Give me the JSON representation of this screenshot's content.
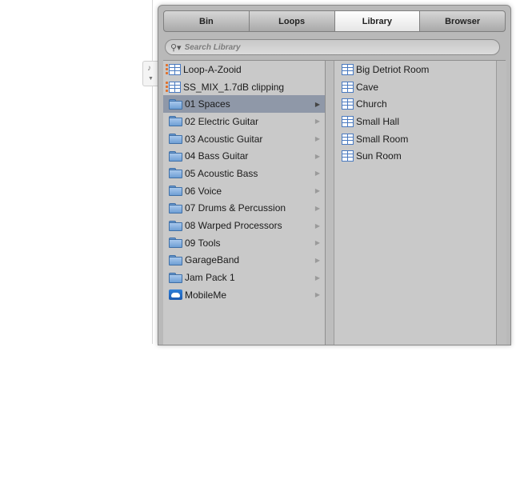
{
  "tabs": [
    {
      "label": "Bin"
    },
    {
      "label": "Loops"
    },
    {
      "label": "Library"
    },
    {
      "label": "Browser"
    }
  ],
  "search": {
    "placeholder": "Search Library"
  },
  "library_items": [
    {
      "label": "Loop-A-Zooid",
      "icon": "setting-file-icon"
    },
    {
      "label": "SS_MIX_1.7dB clipping",
      "icon": "setting-file-icon"
    },
    {
      "label": "01 Spaces",
      "icon": "folder-icon",
      "selected": true
    },
    {
      "label": "02 Electric Guitar",
      "icon": "folder-icon"
    },
    {
      "label": "03 Acoustic Guitar",
      "icon": "folder-icon"
    },
    {
      "label": "04 Bass Guitar",
      "icon": "folder-icon"
    },
    {
      "label": "05 Acoustic Bass",
      "icon": "folder-icon"
    },
    {
      "label": "06 Voice",
      "icon": "folder-icon"
    },
    {
      "label": "07 Drums & Percussion",
      "icon": "folder-icon"
    },
    {
      "label": "08 Warped Processors",
      "icon": "folder-icon"
    },
    {
      "label": "09 Tools",
      "icon": "folder-icon"
    },
    {
      "label": "GarageBand",
      "icon": "folder-icon"
    },
    {
      "label": "Jam Pack 1",
      "icon": "folder-icon"
    },
    {
      "label": "MobileMe",
      "icon": "mobileme-icon"
    }
  ],
  "space_items": [
    {
      "label": "Big Detriot Room",
      "icon": "setting-file-icon"
    },
    {
      "label": "Cave",
      "icon": "setting-file-icon"
    },
    {
      "label": "Church",
      "icon": "setting-file-icon"
    },
    {
      "label": "Small Hall",
      "icon": "setting-file-icon"
    },
    {
      "label": "Small Room",
      "icon": "setting-file-icon"
    },
    {
      "label": "Sun Room",
      "icon": "setting-file-icon"
    }
  ]
}
